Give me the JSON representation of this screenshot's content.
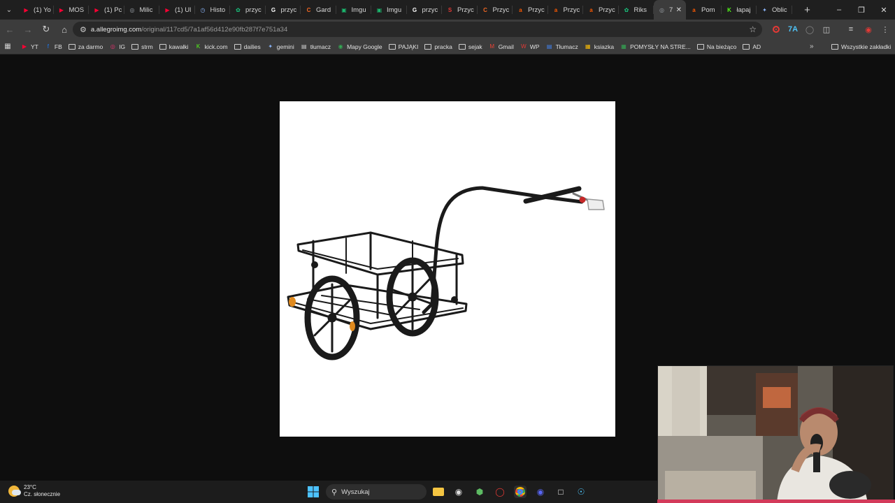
{
  "tabs": [
    {
      "title": "(1) Yo",
      "icon": "youtube-icon",
      "color": "#ff0033"
    },
    {
      "title": "MOS",
      "icon": "youtube-icon",
      "color": "#ff0033"
    },
    {
      "title": "(1) Pc",
      "icon": "youtube-icon",
      "color": "#ff0033"
    },
    {
      "title": "Milic",
      "icon": "globe-icon",
      "color": "#9aa0a6"
    },
    {
      "title": "(1) Ul",
      "icon": "youtube-icon",
      "color": "#ff0033"
    },
    {
      "title": "Histo",
      "icon": "history-icon",
      "color": "#8ab4f8"
    },
    {
      "title": "przyc",
      "icon": "chatgpt-icon",
      "color": "#19c37d"
    },
    {
      "title": "przyc",
      "icon": "google-icon",
      "color": "#ffffff"
    },
    {
      "title": "Gard",
      "icon": "ceneo-icon",
      "color": "#f26722"
    },
    {
      "title": "Imgu",
      "icon": "imgur-icon",
      "color": "#1bb76e"
    },
    {
      "title": "Imgu",
      "icon": "imgur-icon",
      "color": "#1bb76e"
    },
    {
      "title": "przyc",
      "icon": "google-icon",
      "color": "#ffffff"
    },
    {
      "title": "Przyc",
      "icon": "shop-icon",
      "color": "#e53935"
    },
    {
      "title": "Przyc",
      "icon": "ceneo-icon",
      "color": "#f26722"
    },
    {
      "title": "Przyc",
      "icon": "allegro-icon",
      "color": "#ff5a00"
    },
    {
      "title": "Przyc",
      "icon": "allegro-icon",
      "color": "#ff5a00"
    },
    {
      "title": "Przyc",
      "icon": "allegro-icon",
      "color": "#ff5a00"
    },
    {
      "title": "Riks",
      "icon": "chatgpt-icon",
      "color": "#19c37d"
    },
    {
      "title": "7",
      "icon": "globe-icon",
      "color": "#9aa0a6",
      "active": true
    },
    {
      "title": "Pom",
      "icon": "allegro-icon",
      "color": "#ff5a00"
    },
    {
      "title": "łapaj",
      "icon": "kick-icon",
      "color": "#53fc18"
    },
    {
      "title": "Oblic",
      "icon": "gemini-icon",
      "color": "#8ab4f8"
    }
  ],
  "address": {
    "host": "a.allegroimg.com",
    "path": "/original/117cd5/7a1af56d412e90fb287f7e751a34"
  },
  "bookmarks": [
    {
      "label": "YT",
      "icon": "youtube-icon",
      "color": "#ff0033"
    },
    {
      "label": "FB",
      "icon": "facebook-icon",
      "color": "#1877f2"
    },
    {
      "label": "za darmo",
      "icon": "folder-icon",
      "color": "#cfcfcf"
    },
    {
      "label": "IG",
      "icon": "instagram-icon",
      "color": "#e1306c"
    },
    {
      "label": "strm",
      "icon": "folder-icon",
      "color": "#cfcfcf"
    },
    {
      "label": "kawałki",
      "icon": "folder-icon",
      "color": "#cfcfcf"
    },
    {
      "label": "kick.com",
      "icon": "kick-icon",
      "color": "#53fc18"
    },
    {
      "label": "dailies",
      "icon": "folder-icon",
      "color": "#cfcfcf"
    },
    {
      "label": "gemini",
      "icon": "gemini-icon",
      "color": "#8ab4f8"
    },
    {
      "label": "tłumacz",
      "icon": "translate-icon",
      "color": "#cfcfcf"
    },
    {
      "label": "Mapy Google",
      "icon": "maps-icon",
      "color": "#34a853"
    },
    {
      "label": "PAJĄKI",
      "icon": "folder-icon",
      "color": "#cfcfcf"
    },
    {
      "label": "pracka",
      "icon": "folder-icon",
      "color": "#cfcfcf"
    },
    {
      "label": "sejak",
      "icon": "folder-icon",
      "color": "#cfcfcf"
    },
    {
      "label": "Gmail",
      "icon": "gmail-icon",
      "color": "#ea4335"
    },
    {
      "label": "WP",
      "icon": "wp-icon",
      "color": "#e53935"
    },
    {
      "label": "Tłumacz",
      "icon": "translate-icon",
      "color": "#4285f4"
    },
    {
      "label": "ksiazka",
      "icon": "grid-icon",
      "color": "#fbbc04"
    },
    {
      "label": "POMYSŁY NA STRE...",
      "icon": "grid-icon",
      "color": "#34a853"
    },
    {
      "label": "Na bieżąco",
      "icon": "folder-icon",
      "color": "#cfcfcf"
    },
    {
      "label": "AD",
      "icon": "folder-icon",
      "color": "#cfcfcf"
    }
  ],
  "bookmarks_all": "Wszystkie zakładki",
  "taskbar": {
    "weather_temp": "23°C",
    "weather_desc": "Cz. słonecznie",
    "search_placeholder": "Wyszukaj"
  }
}
